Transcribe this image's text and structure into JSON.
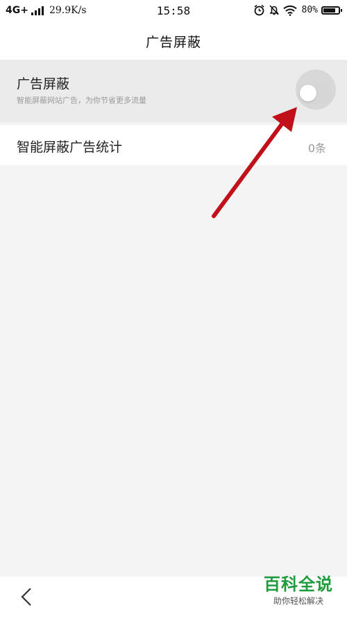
{
  "status_bar": {
    "network": "4G+",
    "speed": "29.9K/s",
    "time": "15:58",
    "battery_text": "80%",
    "battery_level": 0.8,
    "icons": [
      "signal-icon",
      "alarm-icon",
      "mute-bell-icon",
      "wifi-icon",
      "battery-icon"
    ]
  },
  "header": {
    "title": "广告屏蔽"
  },
  "adblock": {
    "title": "广告屏蔽",
    "subtitle": "智能屏蔽网站广告，为你节省更多流量",
    "toggle_on": false
  },
  "stats": {
    "label": "智能屏蔽广告统计",
    "count": "0条"
  },
  "nav": {
    "back_icon": "chevron-left-icon"
  },
  "watermark": {
    "brand": "百科全说",
    "slogan": "助你轻松解决"
  },
  "colors": {
    "arrow": "#c0111a",
    "brand": "#1e9b3c"
  }
}
